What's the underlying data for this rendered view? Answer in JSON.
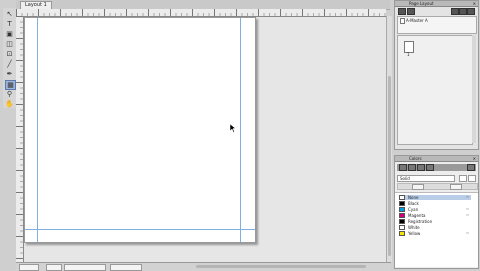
{
  "document_tab": {
    "label": "Layout 1"
  },
  "toolbar": {
    "tools": [
      {
        "icon": "pointer-icon",
        "glyph": "↖"
      },
      {
        "icon": "text-tool-icon",
        "glyph": "T"
      },
      {
        "icon": "frame-tool-icon",
        "glyph": "▣"
      },
      {
        "icon": "shape-tool-icon",
        "glyph": "◫"
      },
      {
        "icon": "image-tool-icon",
        "glyph": "⊡"
      },
      {
        "icon": "line-tool-icon",
        "glyph": "╱"
      },
      {
        "icon": "pen-tool-icon",
        "glyph": "✒"
      },
      {
        "icon": "table-tool-icon",
        "glyph": "▦"
      },
      {
        "icon": "zoom-tool-icon",
        "glyph": "⚲"
      },
      {
        "icon": "pan-tool-icon",
        "glyph": "✋"
      }
    ]
  },
  "pages_panel": {
    "title": "Page Layout",
    "master_label": "A-Master A",
    "page_number": "1"
  },
  "colors_panel": {
    "title": "Colors",
    "search_value": "Solid",
    "swatches": [
      {
        "name": "None",
        "color": "#ffffff",
        "selected": true
      },
      {
        "name": "Black",
        "color": "#000000"
      },
      {
        "name": "Cyan",
        "color": "#00a0e0"
      },
      {
        "name": "Magenta",
        "color": "#d0007a"
      },
      {
        "name": "Registration",
        "color": "#000000"
      },
      {
        "name": "White",
        "color": "#ffffff"
      },
      {
        "name": "Yellow",
        "color": "#f5e600"
      }
    ]
  }
}
